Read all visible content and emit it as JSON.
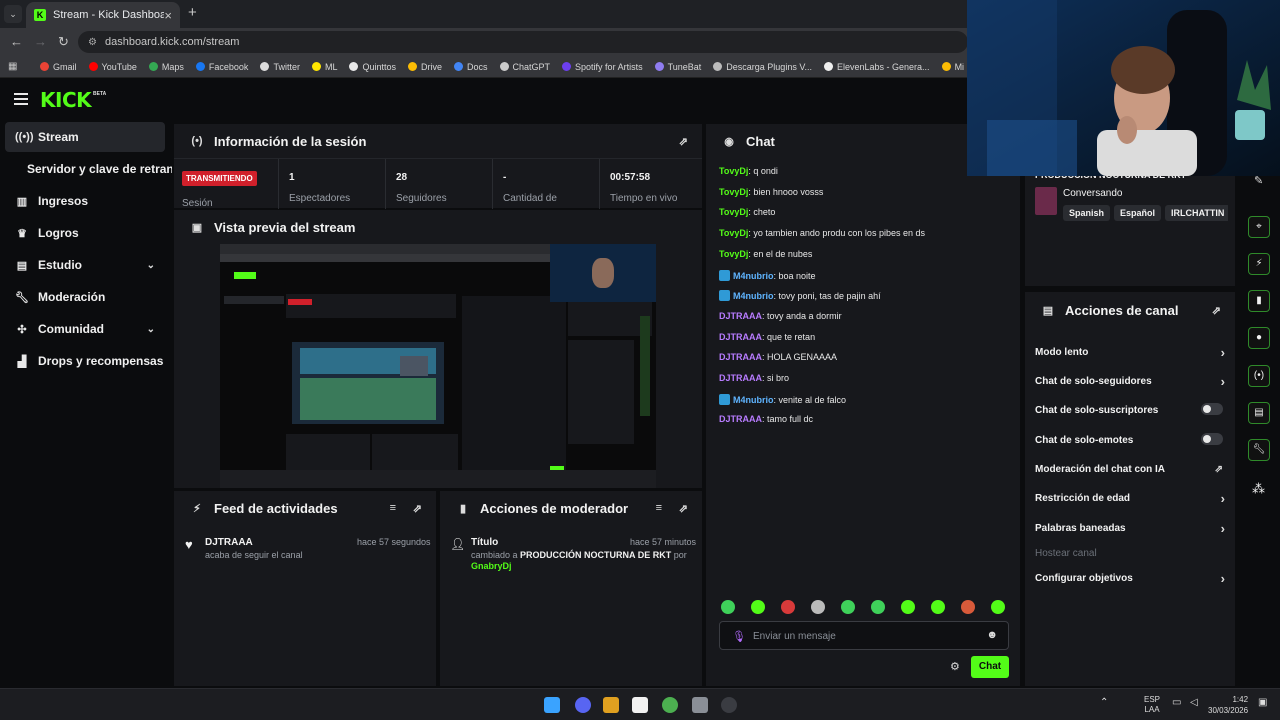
{
  "browser": {
    "tab_title": "Stream - Kick Dashboard",
    "tab_favicon": "K",
    "url": "dashboard.kick.com/stream",
    "bookmarks": [
      {
        "label": "Gmail",
        "color": "#ea4335"
      },
      {
        "label": "YouTube",
        "color": "#ff0000"
      },
      {
        "label": "Maps",
        "color": "#34a853"
      },
      {
        "label": "Facebook",
        "color": "#1877f2"
      },
      {
        "label": "Twitter",
        "color": "#dddddd"
      },
      {
        "label": "ML",
        "color": "#ffe600"
      },
      {
        "label": "Quinttos",
        "color": "#e8e8e8"
      },
      {
        "label": "Drive",
        "color": "#fbbc04"
      },
      {
        "label": "Docs",
        "color": "#4285f4"
      },
      {
        "label": "ChatGPT",
        "color": "#cccccc"
      },
      {
        "label": "Spotify for Artists",
        "color": "#6c3ff0"
      },
      {
        "label": "TuneBat",
        "color": "#8f7cf0"
      },
      {
        "label": "Descarga Plugins V...",
        "color": "#bbbbbb"
      },
      {
        "label": "ElevenLabs - Genera...",
        "color": "#eeeeee"
      },
      {
        "label": "Mi unidad - Google...",
        "color": "#fbbc04"
      }
    ]
  },
  "app": {
    "logo": "KICK",
    "beta": "BETA"
  },
  "sidebar": {
    "items": [
      {
        "label": "Stream",
        "icon": "broadcast-icon"
      },
      {
        "label": "Servidor y clave de retransmisión"
      },
      {
        "label": "Ingresos",
        "icon": "chart-icon"
      },
      {
        "label": "Logros",
        "icon": "trophy-icon"
      },
      {
        "label": "Estudio",
        "icon": "studio-icon"
      },
      {
        "label": "Moderación",
        "icon": "wrench-icon"
      },
      {
        "label": "Comunidad",
        "icon": "community-icon"
      },
      {
        "label": "Drops y recompensas",
        "icon": "drops-icon"
      }
    ]
  },
  "session": {
    "title": "Información de la sesión",
    "live_badge": "TRANSMITIENDO",
    "session_label": "Sesión",
    "stats": [
      {
        "value": "1",
        "label": "Espectadores"
      },
      {
        "value": "28",
        "label": "Seguidores"
      },
      {
        "value": "-",
        "label": "Cantidad de"
      },
      {
        "value": "00:57:58",
        "label": "Tiempo en vivo"
      }
    ]
  },
  "preview": {
    "title": "Vista previa del stream"
  },
  "feed": {
    "title": "Feed de actividades",
    "entries": [
      {
        "user": "DJTRAAA",
        "text": "acaba de seguir el canal",
        "time": "hace 57 segundos"
      }
    ]
  },
  "mod_actions": {
    "title": "Acciones de moderador",
    "entries": [
      {
        "field": "Título",
        "prefix": "cambiado a",
        "value": "PRODUCCIÓN NOCTURNA DE RKT",
        "by": "por",
        "user": "GnabryDj",
        "time": "hace 57 minutos"
      }
    ]
  },
  "chat": {
    "title": "Chat",
    "messages": [
      {
        "user": "TovyDj",
        "text": "q ondi",
        "color": "#53fc18",
        "badge": false
      },
      {
        "user": "TovyDj",
        "text": "bien hnooo vosss",
        "color": "#53fc18",
        "badge": false
      },
      {
        "user": "TovyDj",
        "text": "cheto",
        "color": "#53fc18",
        "badge": false
      },
      {
        "user": "TovyDj",
        "text": "yo tambien ando produ con los pibes en ds",
        "color": "#53fc18",
        "badge": false
      },
      {
        "user": "TovyDj",
        "text": "en el de nubes",
        "color": "#53fc18",
        "badge": false
      },
      {
        "user": "M4nubrio",
        "text": "boa noite",
        "color": "#5fb4ff",
        "badge": true
      },
      {
        "user": "M4nubrio",
        "text": "tovy poni, tas de pajin ahí",
        "color": "#5fb4ff",
        "badge": true
      },
      {
        "user": "DJTRAAA",
        "text": "tovy anda a dormir",
        "color": "#b87cff",
        "badge": false
      },
      {
        "user": "DJTRAAA",
        "text": "que te retan",
        "color": "#b87cff",
        "badge": false
      },
      {
        "user": "DJTRAAA",
        "text": "HOLA GENAAAA",
        "color": "#b87cff",
        "badge": false
      },
      {
        "user": "DJTRAAA",
        "text": "si bro",
        "color": "#b87cff",
        "badge": false
      },
      {
        "user": "M4nubrio",
        "text": "venite al de falco",
        "color": "#5fb4ff",
        "badge": true
      },
      {
        "user": "DJTRAAA",
        "text": "tamo full dc",
        "color": "#b87cff",
        "badge": false
      }
    ],
    "emote_colors": [
      "#3fd15a",
      "#53fc18",
      "#d83a3a",
      "#bbbbbb",
      "#3fd15a",
      "#3fd15a",
      "#53fc18",
      "#53fc18",
      "#d85a3a",
      "#53fc18"
    ],
    "input_placeholder": "Enviar un mensaje",
    "send_label": "Chat"
  },
  "stream_info": {
    "title": "PRODUCCIÓN NOCTURNA DE RKT",
    "category": "Conversando",
    "tags": [
      "Spanish",
      "Español",
      "IRLCHATTIN"
    ]
  },
  "channel_actions": {
    "title": "Acciones de canal",
    "rows": [
      {
        "label": "Modo lento",
        "control": "chevron"
      },
      {
        "label": "Chat de solo-seguidores",
        "control": "chevron"
      },
      {
        "label": "Chat de solo-suscriptores",
        "control": "toggle"
      },
      {
        "label": "Chat de solo-emotes",
        "control": "toggle"
      },
      {
        "label": "Moderación del chat con IA",
        "control": "external"
      },
      {
        "label": "Restricción de edad",
        "control": "chevron"
      },
      {
        "label": "Palabras baneadas",
        "control": "chevron"
      },
      {
        "label": "Hostear canal",
        "control": "disabled"
      },
      {
        "label": "Configurar objetivos",
        "control": "chevron"
      }
    ]
  },
  "taskbar": {
    "lang": "ESP",
    "lang2": "LAA",
    "time": "1:42",
    "date": "30/03/2026"
  }
}
